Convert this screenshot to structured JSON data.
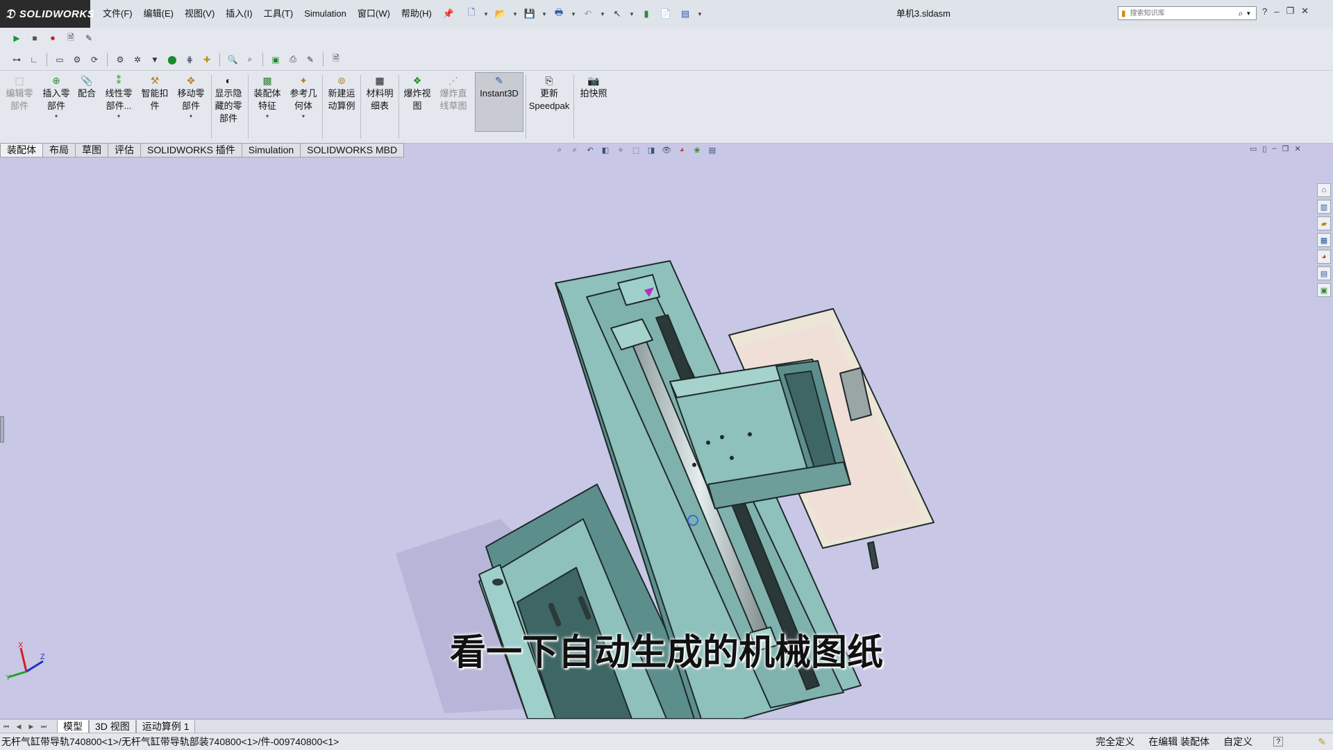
{
  "app": {
    "brand": "SOLIDWORKS",
    "document_title": "单机3.sldasm"
  },
  "menus": [
    "文件(F)",
    "编辑(E)",
    "视图(V)",
    "插入(I)",
    "工具(T)",
    "Simulation",
    "窗口(W)",
    "帮助(H)"
  ],
  "search": {
    "placeholder": "搜索知识库"
  },
  "commands": [
    {
      "label": "编辑零\n部件",
      "disabled": true
    },
    {
      "label": "插入零\n部件"
    },
    {
      "label": "配合"
    },
    {
      "label": "线性零\n部件..."
    },
    {
      "label": "智能扣\n件"
    },
    {
      "label": "移动零\n部件"
    },
    {
      "label": "显示隐\n藏的零\n部件"
    },
    {
      "label": "装配体\n特征"
    },
    {
      "label": "参考几\n何体"
    },
    {
      "label": "新建运\n动算例"
    },
    {
      "label": "材料明\n细表"
    },
    {
      "label": "爆炸视\n图"
    },
    {
      "label": "爆炸直\n线草图",
      "disabled": true
    },
    {
      "label": "Instant3D",
      "active": true
    },
    {
      "label": "更新\nSpeedpak"
    },
    {
      "label": "拍快照"
    }
  ],
  "tabs": [
    "装配体",
    "布局",
    "草图",
    "评估",
    "SOLIDWORKS 插件",
    "Simulation",
    "SOLIDWORKS MBD"
  ],
  "active_tab": "装配体",
  "subtitle": "看一下自动生成的机械图纸",
  "bottom_tabs": [
    "模型",
    "3D 视图",
    "运动算例 1"
  ],
  "status": {
    "path": "无杆气缸带导轨740800<1>/无杆气缸带导轨部装740800<1>/件-009740800<1>",
    "state": "完全定义",
    "mode": "在编辑 装配体",
    "units": "自定义"
  },
  "triad": {
    "x": "X",
    "y": "Y",
    "z": "Z"
  },
  "colors": {
    "viewport": "#c9c7e6",
    "part": "#8ec0bc",
    "plate": "#ede6d6",
    "rod": "#b8c0c0"
  }
}
